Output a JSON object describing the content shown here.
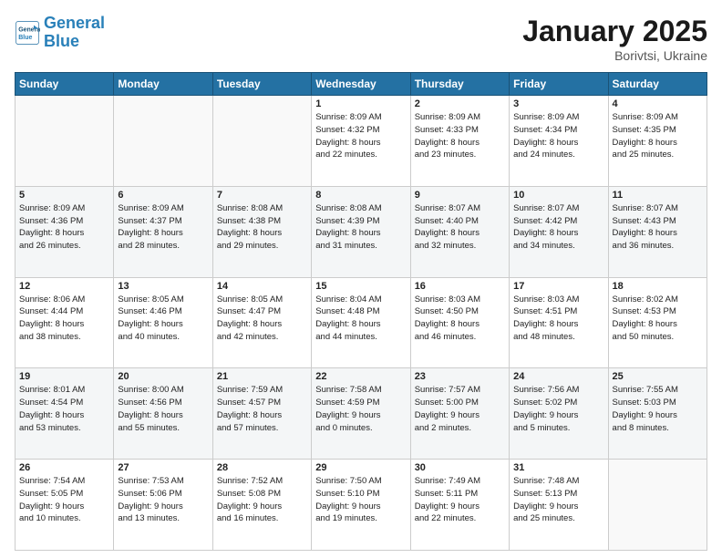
{
  "logo": {
    "line1": "General",
    "line2": "Blue"
  },
  "title": "January 2025",
  "subtitle": "Borivtsi, Ukraine",
  "days_header": [
    "Sunday",
    "Monday",
    "Tuesday",
    "Wednesday",
    "Thursday",
    "Friday",
    "Saturday"
  ],
  "weeks": [
    [
      {
        "day": "",
        "info": ""
      },
      {
        "day": "",
        "info": ""
      },
      {
        "day": "",
        "info": ""
      },
      {
        "day": "1",
        "info": "Sunrise: 8:09 AM\nSunset: 4:32 PM\nDaylight: 8 hours\nand 22 minutes."
      },
      {
        "day": "2",
        "info": "Sunrise: 8:09 AM\nSunset: 4:33 PM\nDaylight: 8 hours\nand 23 minutes."
      },
      {
        "day": "3",
        "info": "Sunrise: 8:09 AM\nSunset: 4:34 PM\nDaylight: 8 hours\nand 24 minutes."
      },
      {
        "day": "4",
        "info": "Sunrise: 8:09 AM\nSunset: 4:35 PM\nDaylight: 8 hours\nand 25 minutes."
      }
    ],
    [
      {
        "day": "5",
        "info": "Sunrise: 8:09 AM\nSunset: 4:36 PM\nDaylight: 8 hours\nand 26 minutes."
      },
      {
        "day": "6",
        "info": "Sunrise: 8:09 AM\nSunset: 4:37 PM\nDaylight: 8 hours\nand 28 minutes."
      },
      {
        "day": "7",
        "info": "Sunrise: 8:08 AM\nSunset: 4:38 PM\nDaylight: 8 hours\nand 29 minutes."
      },
      {
        "day": "8",
        "info": "Sunrise: 8:08 AM\nSunset: 4:39 PM\nDaylight: 8 hours\nand 31 minutes."
      },
      {
        "day": "9",
        "info": "Sunrise: 8:07 AM\nSunset: 4:40 PM\nDaylight: 8 hours\nand 32 minutes."
      },
      {
        "day": "10",
        "info": "Sunrise: 8:07 AM\nSunset: 4:42 PM\nDaylight: 8 hours\nand 34 minutes."
      },
      {
        "day": "11",
        "info": "Sunrise: 8:07 AM\nSunset: 4:43 PM\nDaylight: 8 hours\nand 36 minutes."
      }
    ],
    [
      {
        "day": "12",
        "info": "Sunrise: 8:06 AM\nSunset: 4:44 PM\nDaylight: 8 hours\nand 38 minutes."
      },
      {
        "day": "13",
        "info": "Sunrise: 8:05 AM\nSunset: 4:46 PM\nDaylight: 8 hours\nand 40 minutes."
      },
      {
        "day": "14",
        "info": "Sunrise: 8:05 AM\nSunset: 4:47 PM\nDaylight: 8 hours\nand 42 minutes."
      },
      {
        "day": "15",
        "info": "Sunrise: 8:04 AM\nSunset: 4:48 PM\nDaylight: 8 hours\nand 44 minutes."
      },
      {
        "day": "16",
        "info": "Sunrise: 8:03 AM\nSunset: 4:50 PM\nDaylight: 8 hours\nand 46 minutes."
      },
      {
        "day": "17",
        "info": "Sunrise: 8:03 AM\nSunset: 4:51 PM\nDaylight: 8 hours\nand 48 minutes."
      },
      {
        "day": "18",
        "info": "Sunrise: 8:02 AM\nSunset: 4:53 PM\nDaylight: 8 hours\nand 50 minutes."
      }
    ],
    [
      {
        "day": "19",
        "info": "Sunrise: 8:01 AM\nSunset: 4:54 PM\nDaylight: 8 hours\nand 53 minutes."
      },
      {
        "day": "20",
        "info": "Sunrise: 8:00 AM\nSunset: 4:56 PM\nDaylight: 8 hours\nand 55 minutes."
      },
      {
        "day": "21",
        "info": "Sunrise: 7:59 AM\nSunset: 4:57 PM\nDaylight: 8 hours\nand 57 minutes."
      },
      {
        "day": "22",
        "info": "Sunrise: 7:58 AM\nSunset: 4:59 PM\nDaylight: 9 hours\nand 0 minutes."
      },
      {
        "day": "23",
        "info": "Sunrise: 7:57 AM\nSunset: 5:00 PM\nDaylight: 9 hours\nand 2 minutes."
      },
      {
        "day": "24",
        "info": "Sunrise: 7:56 AM\nSunset: 5:02 PM\nDaylight: 9 hours\nand 5 minutes."
      },
      {
        "day": "25",
        "info": "Sunrise: 7:55 AM\nSunset: 5:03 PM\nDaylight: 9 hours\nand 8 minutes."
      }
    ],
    [
      {
        "day": "26",
        "info": "Sunrise: 7:54 AM\nSunset: 5:05 PM\nDaylight: 9 hours\nand 10 minutes."
      },
      {
        "day": "27",
        "info": "Sunrise: 7:53 AM\nSunset: 5:06 PM\nDaylight: 9 hours\nand 13 minutes."
      },
      {
        "day": "28",
        "info": "Sunrise: 7:52 AM\nSunset: 5:08 PM\nDaylight: 9 hours\nand 16 minutes."
      },
      {
        "day": "29",
        "info": "Sunrise: 7:50 AM\nSunset: 5:10 PM\nDaylight: 9 hours\nand 19 minutes."
      },
      {
        "day": "30",
        "info": "Sunrise: 7:49 AM\nSunset: 5:11 PM\nDaylight: 9 hours\nand 22 minutes."
      },
      {
        "day": "31",
        "info": "Sunrise: 7:48 AM\nSunset: 5:13 PM\nDaylight: 9 hours\nand 25 minutes."
      },
      {
        "day": "",
        "info": ""
      }
    ]
  ]
}
